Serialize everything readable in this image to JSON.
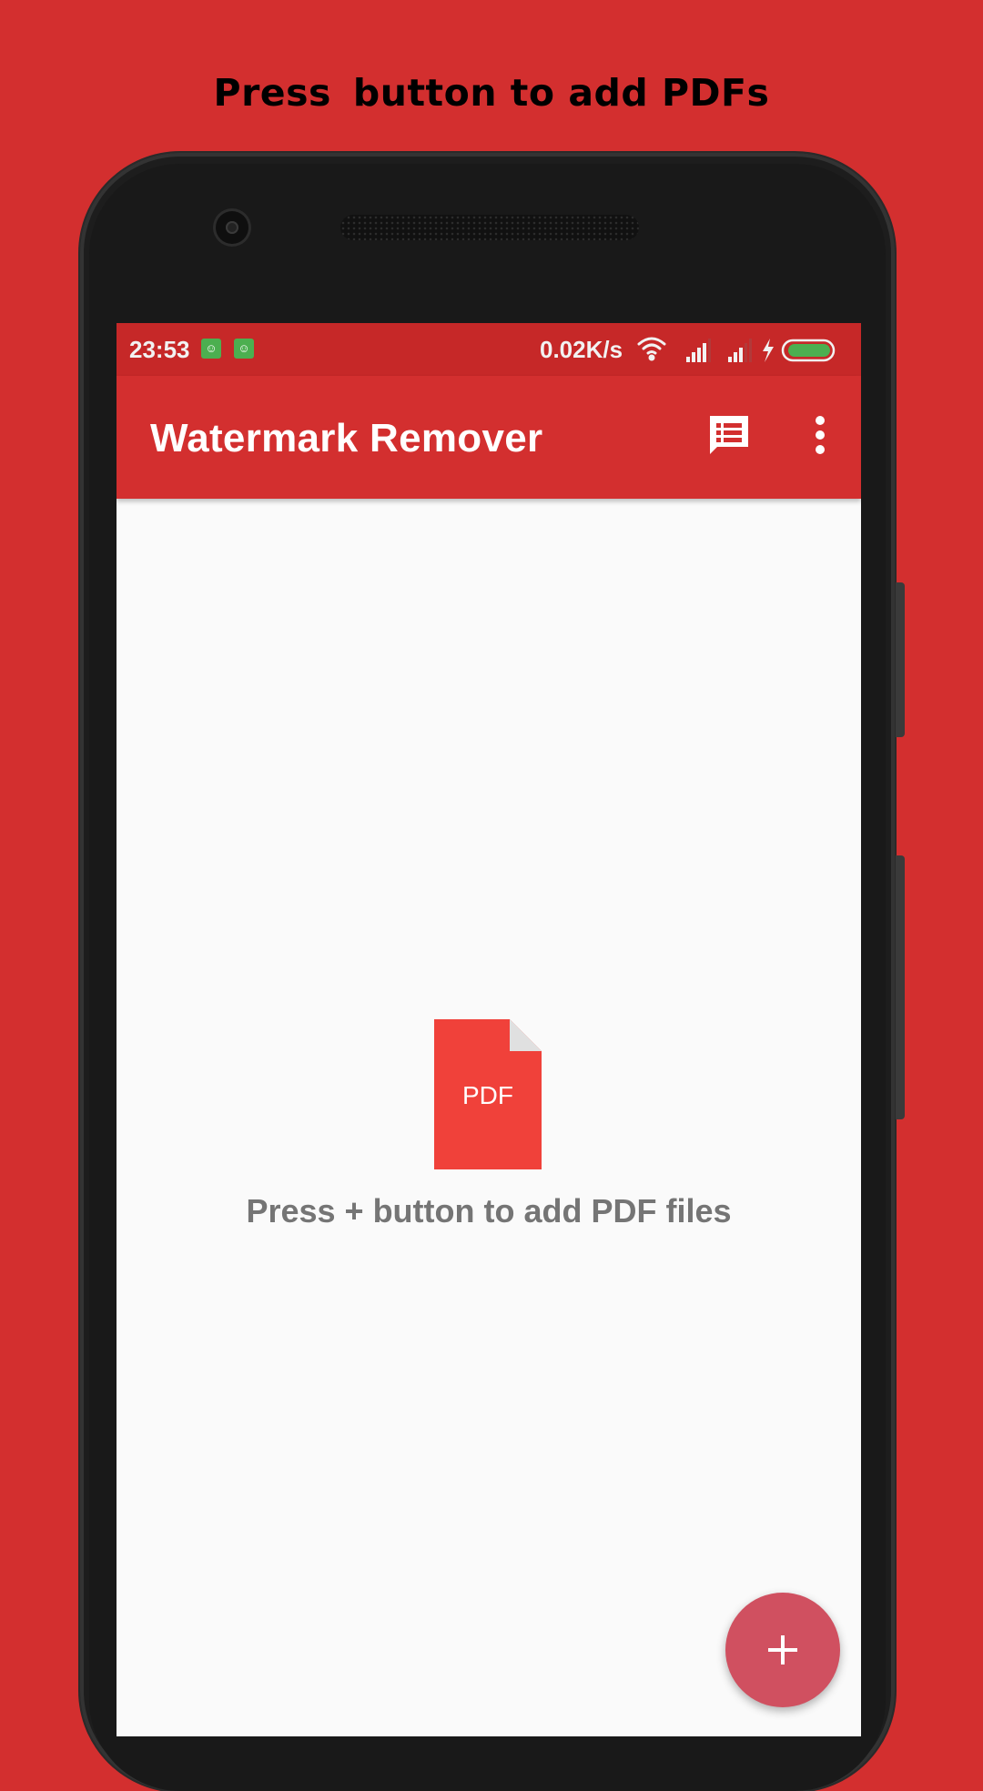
{
  "headline": {
    "part1": "Press",
    "part2": "button to add PDFs"
  },
  "status_bar": {
    "time": "23:53",
    "network_speed": "0.02K/s",
    "icons": [
      "android-notification-icon",
      "android-notification-icon",
      "wifi-icon",
      "signal-icon",
      "signal-icon",
      "charging-icon",
      "battery-icon"
    ]
  },
  "app_bar": {
    "title": "Watermark Remover",
    "actions": [
      "feedback-icon",
      "more-vert-icon"
    ]
  },
  "empty_state": {
    "icon_label": "PDF",
    "message": "Press + button to add PDF files"
  },
  "fab": {
    "icon": "add-icon"
  },
  "colors": {
    "background": "#d32f2f",
    "app_bar": "#d32f2f",
    "status_bar": "#c62828",
    "pdf_icon": "#f0413a",
    "fab": "#d05060",
    "battery": "#4caf50"
  }
}
